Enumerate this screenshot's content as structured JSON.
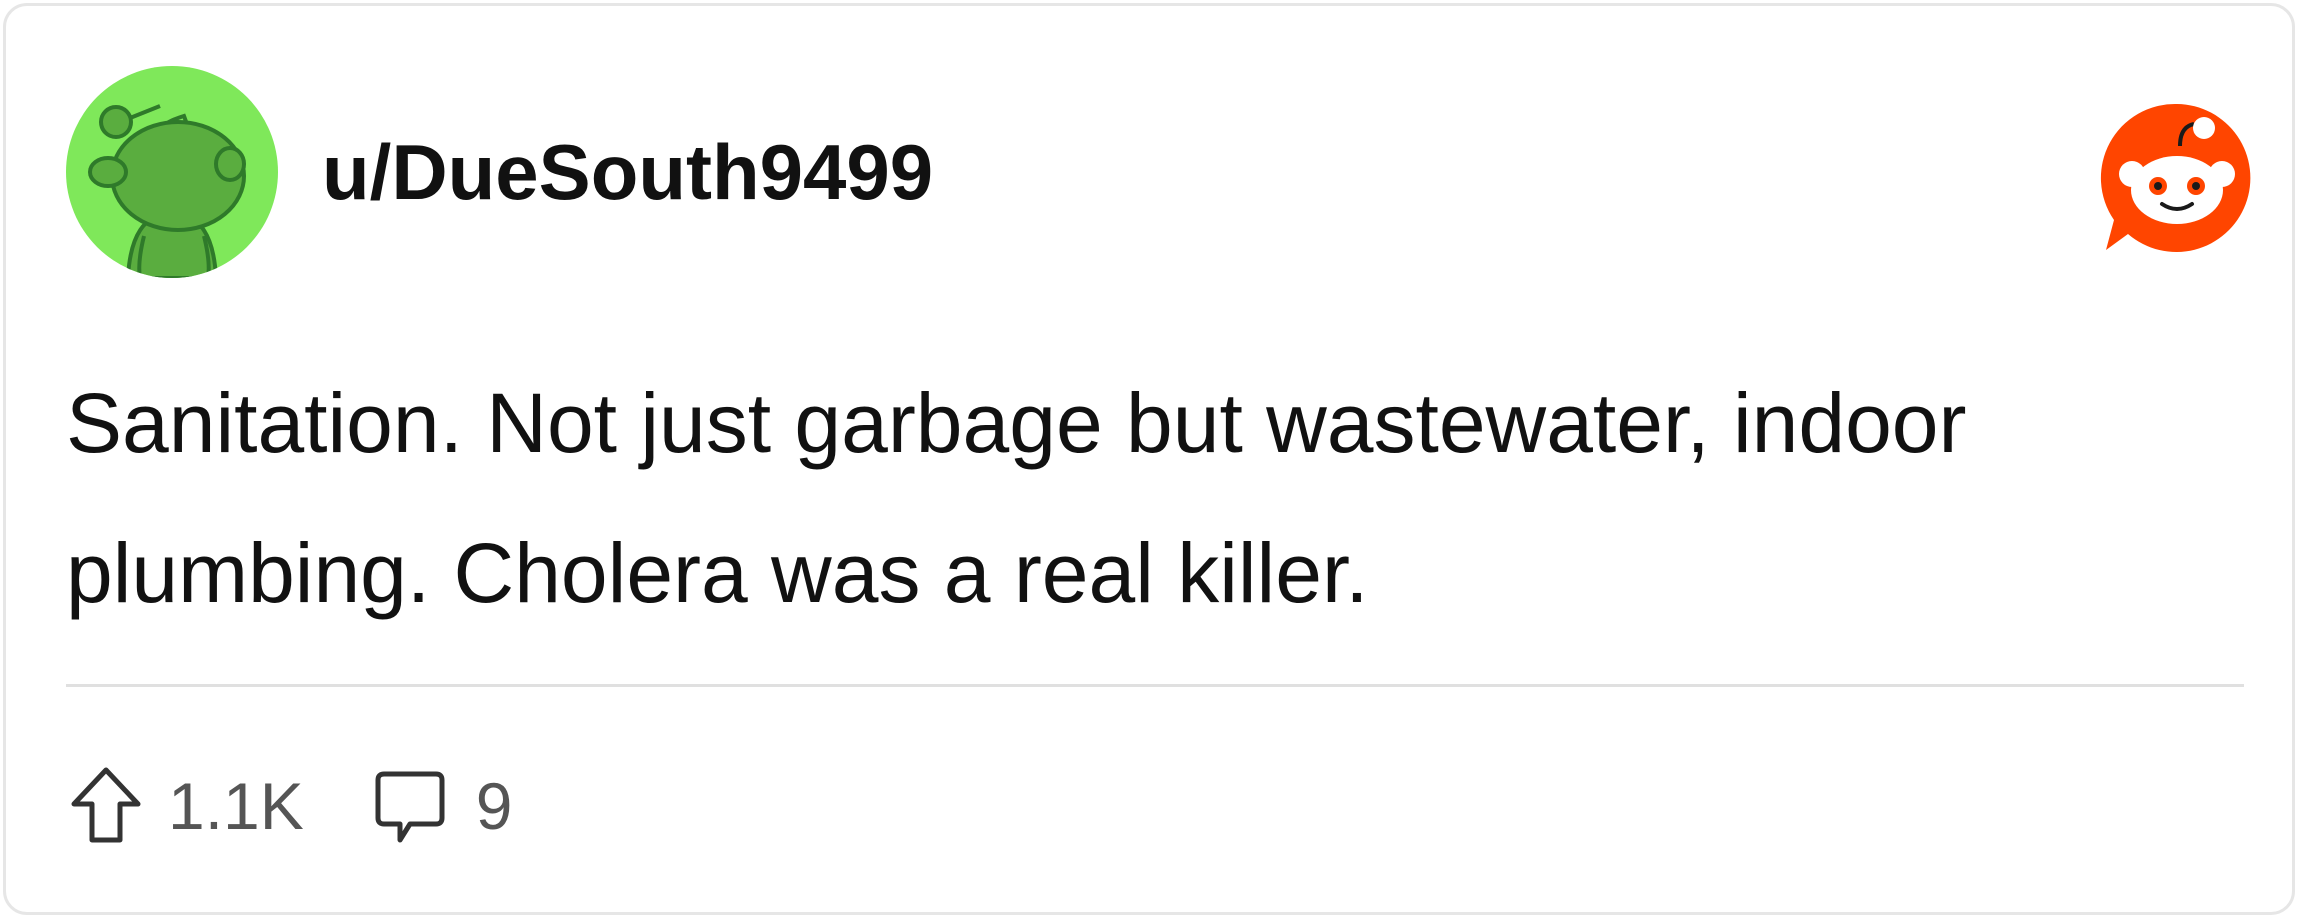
{
  "post": {
    "username": "u/DueSouth9499",
    "body": "Sanitation. Not just garbage but wastewater, indoor plumbing. Cholera was a real killer.",
    "upvotes": "1.1K",
    "comments": "9"
  },
  "icons": {
    "avatar": "snoo-avatar-icon",
    "brand": "reddit-logo-icon",
    "upvote": "upvote-arrow-icon",
    "comment": "comment-bubble-icon"
  },
  "colors": {
    "avatar_bg": "#7fe85a",
    "brand": "#ff4500",
    "text": "#111111",
    "muted": "#555555"
  }
}
